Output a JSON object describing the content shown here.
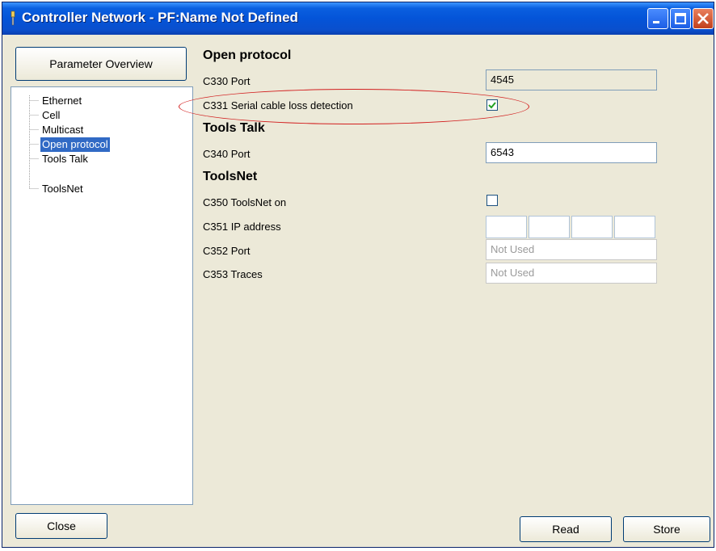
{
  "window": {
    "title": "Controller Network - PF:Name Not Defined"
  },
  "left": {
    "overview_button": "Parameter Overview",
    "tree": [
      "Ethernet",
      "Cell",
      "Multicast",
      "Open protocol",
      "Tools Talk",
      "ToolsNet"
    ],
    "selected": "Open protocol"
  },
  "open_protocol": {
    "title": "Open protocol",
    "port_label": "C330 Port",
    "port_value": "4545",
    "serial_label": "C331 Serial cable loss detection",
    "serial_checked": true
  },
  "tools_talk": {
    "title": "Tools Talk",
    "port_label": "C340 Port",
    "port_value": "6543"
  },
  "toolsnet": {
    "title": "ToolsNet",
    "on_label": "C350 ToolsNet on",
    "on_checked": false,
    "ip_label": "C351 IP address",
    "port_label": "C352 Port",
    "port_value": "Not Used",
    "traces_label": "C353 Traces",
    "traces_value": "Not Used"
  },
  "buttons": {
    "close": "Close",
    "read": "Read",
    "store": "Store"
  },
  "colors": {
    "titlebar": "#0454d8",
    "selection": "#316ac5",
    "annotation": "#d21e1e"
  }
}
